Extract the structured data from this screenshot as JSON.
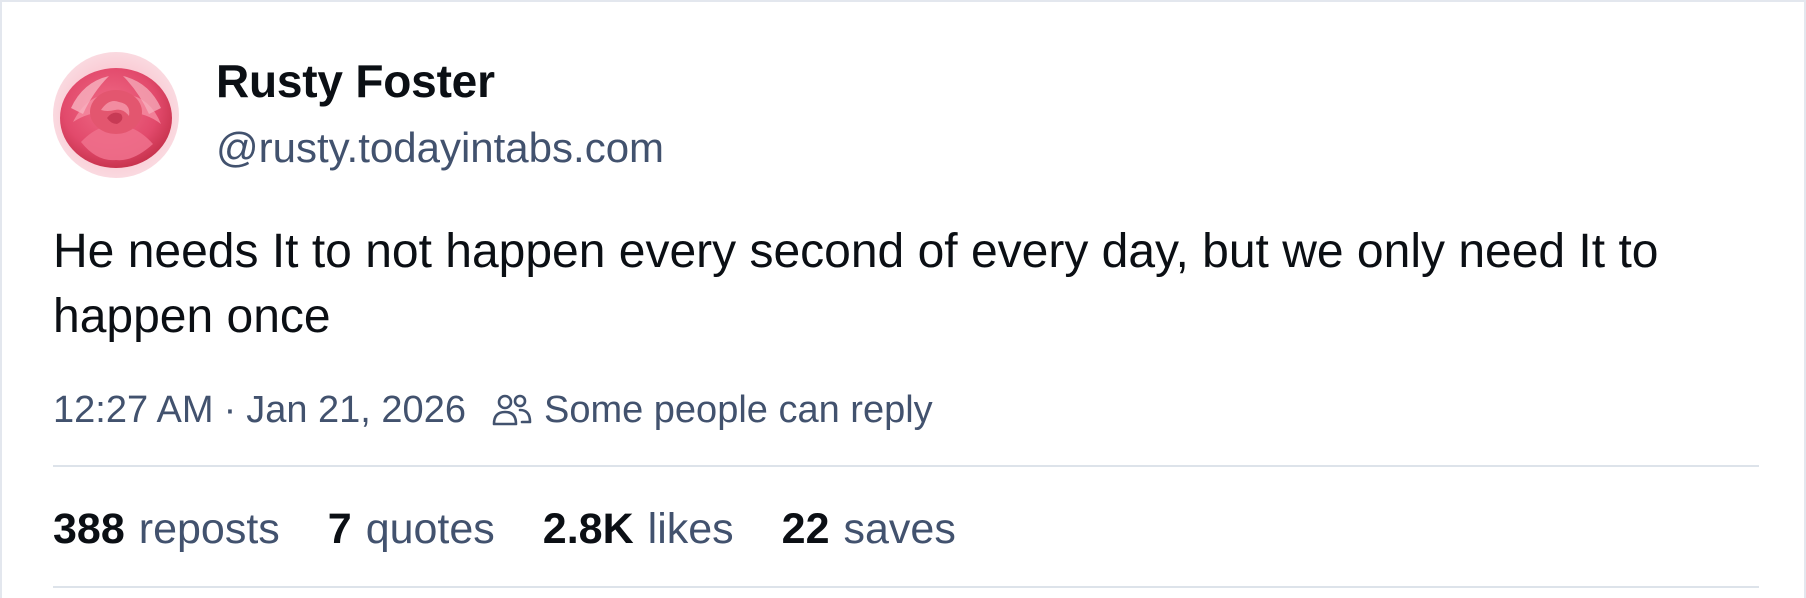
{
  "author": {
    "name": "Rusty Foster",
    "handle": "@rusty.todayintabs.com"
  },
  "post": {
    "text": "He needs It to not happen every second of every day, but we only need It to happen once",
    "time": "12:27 AM",
    "separator": "·",
    "date": "Jan 21, 2026",
    "reply_setting": "Some people can reply"
  },
  "stats": [
    {
      "count": "388",
      "label": "reposts"
    },
    {
      "count": "7",
      "label": "quotes"
    },
    {
      "count": "2.8K",
      "label": "likes"
    },
    {
      "count": "22",
      "label": "saves"
    }
  ],
  "icons": {
    "avatar": "rose-photo",
    "reply_setting": "people-icon"
  },
  "colors": {
    "text_primary": "#0b0f14",
    "text_secondary": "#42526e",
    "divider": "#dde3ea"
  }
}
